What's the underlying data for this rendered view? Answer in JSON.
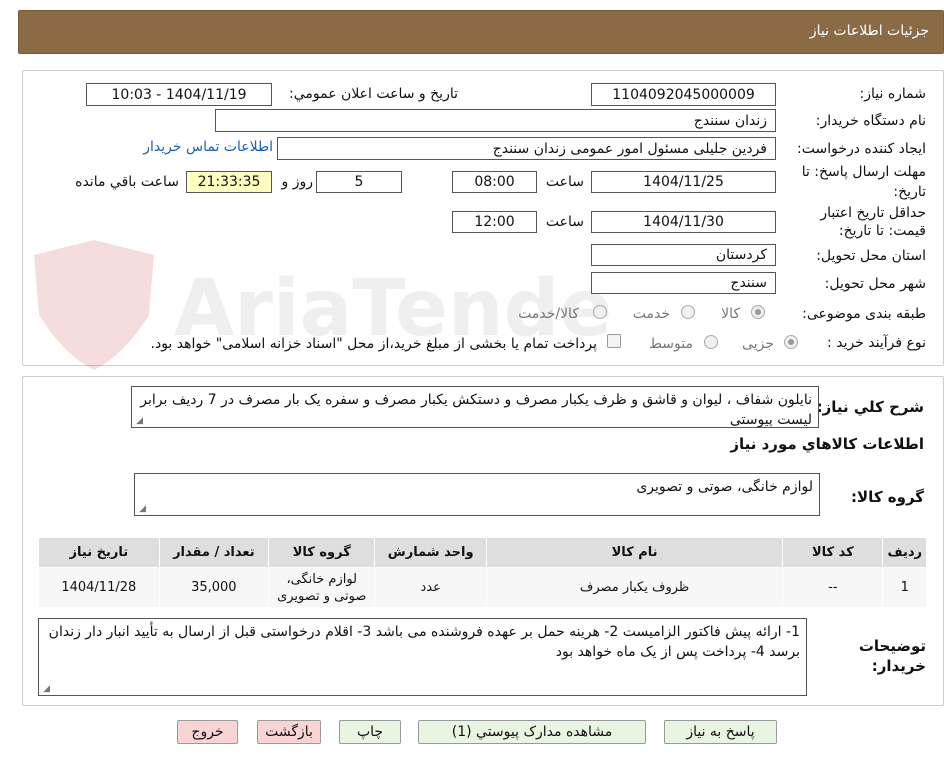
{
  "header": {
    "title": "جزئیات اطلاعات نیاز"
  },
  "watermark": {
    "text": "AriaTender.net"
  },
  "form": {
    "need_number_label": "شماره نیاز:",
    "need_number": "1104092045000009",
    "announce_label": "تاریخ و ساعت اعلان عمومي:",
    "announce_value": "1404/11/19 - 10:03",
    "buyer_org_label": "نام دستگاه خريدار:",
    "buyer_org": "زندان سنندج",
    "creator_label": "ايجاد کننده درخواست:",
    "creator": "فردین جلیلی مسئول امور عمومی  زندان سنندج",
    "contact_link": "اطلاعات تماس خريدار",
    "deadline_label_1": "مهلت ارسال پاسخ: تا",
    "deadline_label_2": "تاريخ:",
    "deadline_date": "1404/11/25",
    "time_label": "ساعت",
    "deadline_time": "08:00",
    "days_value": "5",
    "days_label": "روز و",
    "remaining_time": "21:33:35",
    "remaining_label": "ساعت باقي مانده",
    "validity_label_1": "حداقل تاريخ اعتبار",
    "validity_label_2": "قيمت: تا تاريخ:",
    "validity_date": "1404/11/30",
    "validity_time": "12:00",
    "province_label": "استان محل تحويل:",
    "province": "کردستان",
    "city_label": "شهر محل تحويل:",
    "city": "سنندج",
    "category_label": "طبقه بندی موضوعی:",
    "category_options": [
      "کالا",
      "خدمت",
      "کالا/خدمت"
    ],
    "process_label": "نوع فرآيند خريد :",
    "process_options": [
      "جزیی",
      "متوسط"
    ],
    "process_note": "پرداخت تمام يا بخشی از مبلغ خريد،از محل \"اسناد خزانه اسلامی\" خواهد بود."
  },
  "summary": {
    "title": "شرح کلي نياز:",
    "text": "نایلون شفاف ، لیوان و قاشق و ظرف یکبار مصرف و دستکش یکبار مصرف و سفره یک بار مصرف در 7 ردیف برابر لیست پیوستی"
  },
  "goods": {
    "title": "اطلاعات کالاهاي مورد نياز",
    "group_label": "گروه کالا:",
    "group_value": "لوازم خانگی، صوتی و تصویری",
    "columns": [
      "رديف",
      "کد کالا",
      "نام کالا",
      "واحد شمارش",
      "گروه کالا",
      "تعداد / مقدار",
      "تاريخ نياز"
    ],
    "rows": [
      [
        "1",
        "--",
        "ظروف یکبار مصرف",
        "عدد",
        "لوازم خانگی، صوتی و تصویری",
        "35,000",
        "1404/11/28"
      ]
    ]
  },
  "buyer_notes": {
    "label_1": "توضيحات",
    "label_2": "خريدار:",
    "text": "1- ارائه پیش فاکتور الزامیست 2- هرینه حمل بر عهده فروشنده می باشد 3- اقلام درخواستی قبل از ارسال به تأیید انبار دار زندان برسد 4- پرداخت پس از یک ماه خواهد بود"
  },
  "buttons": {
    "reply": "پاسخ به نياز",
    "attachments": "مشاهده مدارک پيوستي (1)",
    "print": "چاپ",
    "back": "بازگشت",
    "exit": "خروج"
  }
}
